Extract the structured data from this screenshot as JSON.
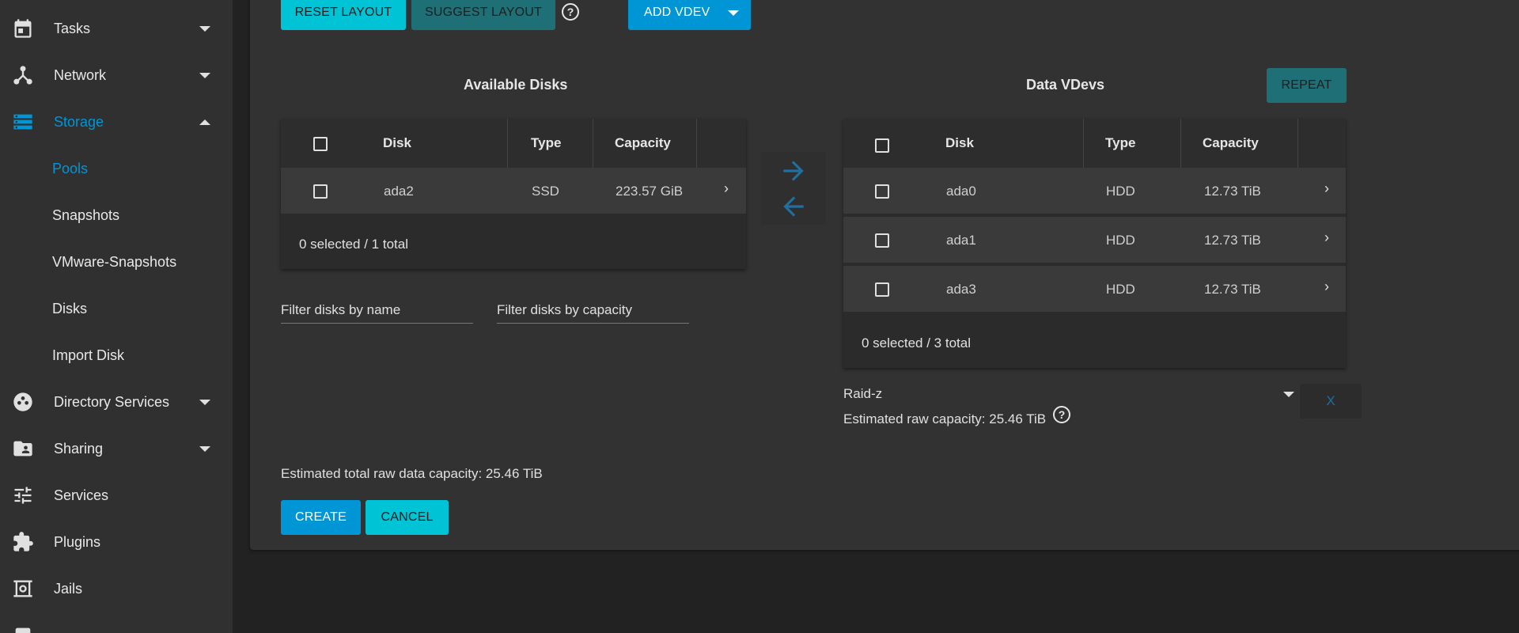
{
  "sidebar": {
    "items": [
      {
        "label": "Tasks",
        "icon": "calendar-icon"
      },
      {
        "label": "Network",
        "icon": "network-icon"
      },
      {
        "label": "Storage",
        "icon": "storage-icon"
      },
      {
        "label": "Directory Services",
        "icon": "directory-services-icon"
      },
      {
        "label": "Sharing",
        "icon": "sharing-icon"
      },
      {
        "label": "Services",
        "icon": "services-sliders-icon"
      },
      {
        "label": "Plugins",
        "icon": "plugins-puzzle-icon"
      },
      {
        "label": "Jails",
        "icon": "jails-icon"
      }
    ],
    "storage_sub": [
      "Pools",
      "Snapshots",
      "VMware-Snapshots",
      "Disks",
      "Import Disk"
    ],
    "active_color": "#0095d5"
  },
  "toolbar": {
    "reset_layout": "RESET LAYOUT",
    "suggest_layout": "SUGGEST LAYOUT",
    "add_vdev": "ADD VDEV"
  },
  "available": {
    "title": "Available Disks",
    "headers": {
      "disk": "Disk",
      "type": "Type",
      "capacity": "Capacity"
    },
    "rows": [
      {
        "disk": "ada2",
        "type": "SSD",
        "capacity": "223.57 GiB"
      }
    ],
    "footer": "0 selected / 1 total",
    "filter_name_placeholder": "Filter disks by name",
    "filter_capacity_placeholder": "Filter disks by capacity"
  },
  "data_vdevs": {
    "title": "Data VDevs",
    "repeat_label": "REPEAT",
    "headers": {
      "disk": "Disk",
      "type": "Type",
      "capacity": "Capacity"
    },
    "rows": [
      {
        "disk": "ada0",
        "type": "HDD",
        "capacity": "12.73 TiB"
      },
      {
        "disk": "ada1",
        "type": "HDD",
        "capacity": "12.73 TiB"
      },
      {
        "disk": "ada3",
        "type": "HDD",
        "capacity": "12.73 TiB"
      }
    ],
    "footer": "0 selected / 3 total",
    "layout_value": "Raid-z",
    "estimated": "Estimated raw capacity: 25.46 TiB",
    "remove_label": "X"
  },
  "summary": {
    "total": "Estimated total raw data capacity: 25.46 TiB",
    "create_label": "CREATE",
    "cancel_label": "CANCEL"
  }
}
